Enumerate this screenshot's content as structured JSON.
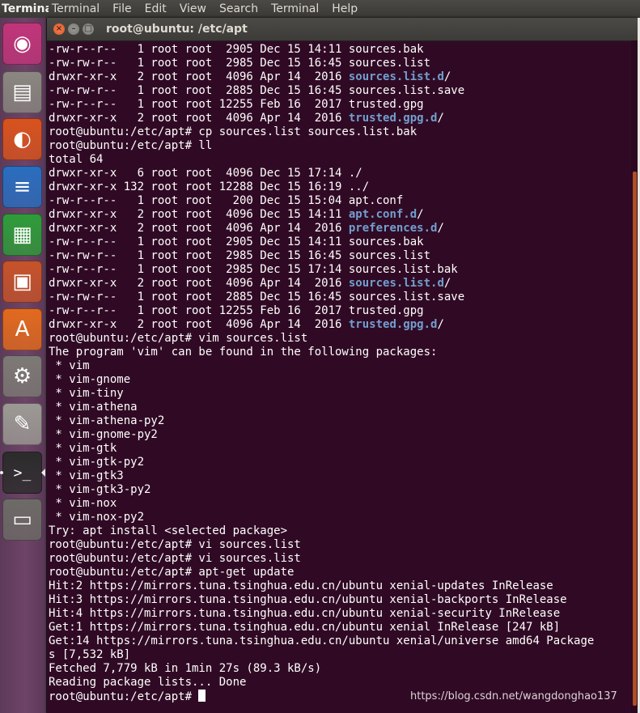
{
  "topbar": {
    "app_name": "Terminal",
    "menus": [
      "Terminal",
      "File",
      "Edit",
      "View",
      "Search",
      "Terminal",
      "Help"
    ]
  },
  "launcher": {
    "items": [
      {
        "name": "ubuntu-dash-icon",
        "color": "#c1357a"
      },
      {
        "name": "files-icon",
        "color": "#8a8780"
      },
      {
        "name": "firefox-icon",
        "color": "#d9531e"
      },
      {
        "name": "libreoffice-writer-icon",
        "color": "#2a6ebf"
      },
      {
        "name": "libreoffice-calc-icon",
        "color": "#2f9c3a"
      },
      {
        "name": "libreoffice-impress-icon",
        "color": "#c6532a"
      },
      {
        "name": "ubuntu-software-icon",
        "color": "#e26a1e"
      },
      {
        "name": "system-settings-icon",
        "color": "#7d7a75"
      },
      {
        "name": "text-editor-icon",
        "color": "#9c9a94"
      },
      {
        "name": "terminal-icon",
        "color": "#2c2c2c"
      },
      {
        "name": "floppy-save-icon",
        "color": "#6d6b67"
      }
    ]
  },
  "window": {
    "title": "root@ubuntu: /etc/apt",
    "close_glyph": "×",
    "min_glyph": "–",
    "max_glyph": "□"
  },
  "terminal": {
    "lines": [
      [
        [
          "-rw-r--r--   1 root root  2905 Dec 15 14:11 sources.bak",
          ""
        ]
      ],
      [
        [
          "-rw-rw-r--   1 root root  2985 Dec 15 16:45 sources.list",
          ""
        ]
      ],
      [
        [
          "drwxr-xr-x   2 root root  4096 Apr 14  2016 ",
          ""
        ],
        [
          "sources.list.d",
          "dir"
        ],
        [
          "/",
          ""
        ]
      ],
      [
        [
          "-rw-rw-r--   1 root root  2885 Dec 15 16:45 sources.list.save",
          ""
        ]
      ],
      [
        [
          "-rw-r--r--   1 root root 12255 Feb 16  2017 trusted.gpg",
          ""
        ]
      ],
      [
        [
          "drwxr-xr-x   2 root root  4096 Apr 14  2016 ",
          ""
        ],
        [
          "trusted.gpg.d",
          "dir"
        ],
        [
          "/",
          ""
        ]
      ],
      [
        [
          "root@ubuntu:/etc/apt# cp sources.list sources.list.bak",
          ""
        ]
      ],
      [
        [
          "root@ubuntu:/etc/apt# ll",
          ""
        ]
      ],
      [
        [
          "total 64",
          ""
        ]
      ],
      [
        [
          "drwxr-xr-x   6 root root  4096 Dec 15 17:14 ./",
          ""
        ]
      ],
      [
        [
          "drwxr-xr-x 132 root root 12288 Dec 15 16:19 ../",
          ""
        ]
      ],
      [
        [
          "-rw-r--r--   1 root root   200 Dec 15 15:04 apt.conf",
          ""
        ]
      ],
      [
        [
          "drwxr-xr-x   2 root root  4096 Dec 15 14:11 ",
          ""
        ],
        [
          "apt.conf.d",
          "dir"
        ],
        [
          "/",
          ""
        ]
      ],
      [
        [
          "drwxr-xr-x   2 root root  4096 Apr 14  2016 ",
          ""
        ],
        [
          "preferences.d",
          "dir"
        ],
        [
          "/",
          ""
        ]
      ],
      [
        [
          "-rw-r--r--   1 root root  2905 Dec 15 14:11 sources.bak",
          ""
        ]
      ],
      [
        [
          "-rw-rw-r--   1 root root  2985 Dec 15 16:45 sources.list",
          ""
        ]
      ],
      [
        [
          "-rw-r--r--   1 root root  2985 Dec 15 17:14 sources.list.bak",
          ""
        ]
      ],
      [
        [
          "drwxr-xr-x   2 root root  4096 Apr 14  2016 ",
          ""
        ],
        [
          "sources.list.d",
          "dir"
        ],
        [
          "/",
          ""
        ]
      ],
      [
        [
          "-rw-rw-r--   1 root root  2885 Dec 15 16:45 sources.list.save",
          ""
        ]
      ],
      [
        [
          "-rw-r--r--   1 root root 12255 Feb 16  2017 trusted.gpg",
          ""
        ]
      ],
      [
        [
          "drwxr-xr-x   2 root root  4096 Apr 14  2016 ",
          ""
        ],
        [
          "trusted.gpg.d",
          "dir"
        ],
        [
          "/",
          ""
        ]
      ],
      [
        [
          "root@ubuntu:/etc/apt# vim sources.list",
          ""
        ]
      ],
      [
        [
          "The program 'vim' can be found in the following packages:",
          ""
        ]
      ],
      [
        [
          " * vim",
          ""
        ]
      ],
      [
        [
          " * vim-gnome",
          ""
        ]
      ],
      [
        [
          " * vim-tiny",
          ""
        ]
      ],
      [
        [
          " * vim-athena",
          ""
        ]
      ],
      [
        [
          " * vim-athena-py2",
          ""
        ]
      ],
      [
        [
          " * vim-gnome-py2",
          ""
        ]
      ],
      [
        [
          " * vim-gtk",
          ""
        ]
      ],
      [
        [
          " * vim-gtk-py2",
          ""
        ]
      ],
      [
        [
          " * vim-gtk3",
          ""
        ]
      ],
      [
        [
          " * vim-gtk3-py2",
          ""
        ]
      ],
      [
        [
          " * vim-nox",
          ""
        ]
      ],
      [
        [
          " * vim-nox-py2",
          ""
        ]
      ],
      [
        [
          "Try: apt install <selected package>",
          ""
        ]
      ],
      [
        [
          "root@ubuntu:/etc/apt# vi sources.list",
          ""
        ]
      ],
      [
        [
          "root@ubuntu:/etc/apt# vi sources.list",
          ""
        ]
      ],
      [
        [
          "root@ubuntu:/etc/apt# apt-get update",
          ""
        ]
      ],
      [
        [
          "Hit:2 https://mirrors.tuna.tsinghua.edu.cn/ubuntu xenial-updates InRelease",
          ""
        ]
      ],
      [
        [
          "Hit:3 https://mirrors.tuna.tsinghua.edu.cn/ubuntu xenial-backports InRelease",
          ""
        ]
      ],
      [
        [
          "Hit:4 https://mirrors.tuna.tsinghua.edu.cn/ubuntu xenial-security InRelease",
          ""
        ]
      ],
      [
        [
          "Get:1 https://mirrors.tuna.tsinghua.edu.cn/ubuntu xenial InRelease [247 kB]",
          ""
        ]
      ],
      [
        [
          "Get:14 https://mirrors.tuna.tsinghua.edu.cn/ubuntu xenial/universe amd64 Package",
          ""
        ]
      ],
      [
        [
          "s [7,532 kB]",
          ""
        ]
      ],
      [
        [
          "Fetched 7,779 kB in 1min 27s (89.3 kB/s)",
          ""
        ]
      ],
      [
        [
          "Reading package lists... Done",
          ""
        ]
      ],
      [
        [
          "root@ubuntu:/etc/apt# ",
          ""
        ]
      ]
    ]
  },
  "watermark": "https://blog.csdn.net/wangdonghao137",
  "colors": {
    "terminal_bg": "#300a24",
    "terminal_fg": "#ffffff",
    "directory": "#729fcf"
  }
}
